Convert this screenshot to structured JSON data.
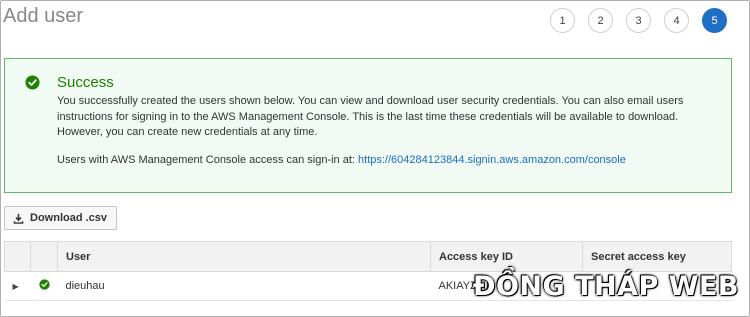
{
  "page": {
    "title": "Add user"
  },
  "steps": [
    "1",
    "2",
    "3",
    "4",
    "5"
  ],
  "active_step": "5",
  "alert": {
    "title": "Success",
    "message": "You successfully created the users shown below. You can view and download user security credentials. You can also email users instructions for signing in to the AWS Management Console. This is the last time these credentials will be available to download. However, you can create new credentials at any time.",
    "signin_prefix": "Users with AWS Management Console access can sign-in at: ",
    "signin_url": "https://604284123844.signin.aws.amazon.com/console"
  },
  "toolbar": {
    "download_label": "Download .csv"
  },
  "table": {
    "columns": [
      "",
      "",
      "User",
      "Access key ID",
      "Secret access key"
    ],
    "rows": [
      {
        "user": "dieuhau",
        "access_key_id": "AKIAYZMR",
        "secret_access_key": ""
      }
    ]
  },
  "watermark": "ĐỒNG THÁP WEB",
  "colors": {
    "success": "#1d8102",
    "accent": "#1f6fc6",
    "link": "#1a6cc7"
  },
  "icons": {
    "success": "check-circle-icon",
    "download": "download-icon",
    "expand": "caret-right-icon"
  }
}
